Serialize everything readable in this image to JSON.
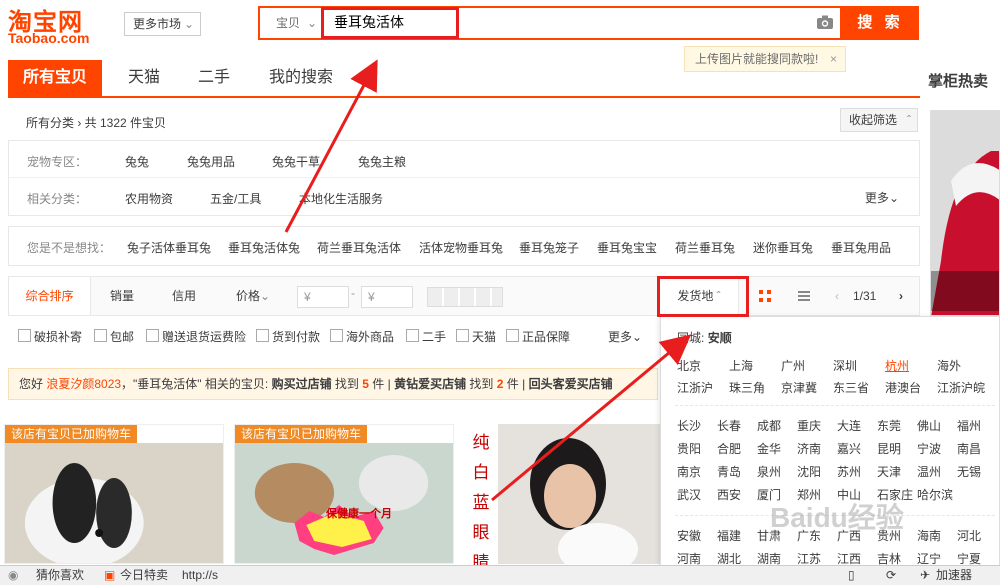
{
  "header": {
    "logo_cn": "淘宝网",
    "logo_en": "Taobao.com",
    "more_market": "更多市场",
    "search_type": "宝贝",
    "search_value": "垂耳兔活体",
    "search_button": "搜 索",
    "image_search_tip": "上传图片就能搜同款啦!",
    "tip_close": "×"
  },
  "tabs": [
    "所有宝贝",
    "天猫",
    "二手",
    "我的搜索"
  ],
  "side": {
    "title": "掌柜热卖"
  },
  "breadcrumb": "所有分类 › 共 1322 件宝贝",
  "fold_filter": "收起筛选",
  "categories": {
    "pet_label": "宠物专区：",
    "pet_items": [
      "兔兔",
      "兔兔用品",
      "兔兔干草",
      "兔兔主粮"
    ],
    "related_label": "相关分类：",
    "related_items": [
      "农用物资",
      "五金/工具",
      "本地化生活服务"
    ],
    "more": "更多"
  },
  "suggestions": {
    "label": "您是不是想找：",
    "items": [
      "兔子活体垂耳兔",
      "垂耳兔活体兔",
      "荷兰垂耳兔活体",
      "活体宠物垂耳兔",
      "垂耳兔笼子",
      "垂耳兔宝宝",
      "荷兰垂耳兔",
      "迷你垂耳兔",
      "垂耳兔用品"
    ]
  },
  "sort": {
    "items": [
      "综合排序",
      "销量",
      "信用",
      "价格"
    ],
    "price_from": "¥",
    "price_to": "¥",
    "ship_from": "发货地",
    "page": "1/31"
  },
  "filters": [
    "破损补寄",
    "包邮",
    "赠送退货运费险",
    "货到付款",
    "海外商品",
    "二手",
    "天猫",
    "正品保障"
  ],
  "filters_more": "更多",
  "notice": {
    "text1": "您好 ",
    "user": "浪夏汐颜8023",
    "text2": "，\"垂耳兔活体\" 相关的宝贝: ",
    "s1": "购买过店铺",
    "t1": " 找到 ",
    "n1": "5",
    "u1": " 件 ",
    "s2": "黄钻爱买店铺",
    "n2": "2",
    "s3": "回头客爱买店铺",
    "sep": " | "
  },
  "dropdown": {
    "same_city_label": "同城:",
    "same_city": "安顺",
    "row1": [
      "北京",
      "上海",
      "广州",
      "深圳",
      "杭州",
      "海外"
    ],
    "row2": [
      "江浙沪",
      "珠三角",
      "京津冀",
      "东三省",
      "港澳台",
      "江浙沪皖"
    ],
    "grid1": [
      [
        "长沙",
        "长春",
        "成都",
        "重庆",
        "大连",
        "东莞",
        "佛山",
        "福州"
      ],
      [
        "贵阳",
        "合肥",
        "金华",
        "济南",
        "嘉兴",
        "昆明",
        "宁波",
        "南昌"
      ],
      [
        "南京",
        "青岛",
        "泉州",
        "沈阳",
        "苏州",
        "天津",
        "温州",
        "无锡"
      ],
      [
        "武汉",
        "西安",
        "厦门",
        "郑州",
        "中山",
        "石家庄",
        "哈尔滨",
        ""
      ]
    ],
    "grid2": [
      [
        "安徽",
        "福建",
        "甘肃",
        "广东",
        "广西",
        "贵州",
        "海南",
        "河北"
      ],
      [
        "河南",
        "湖北",
        "湖南",
        "江苏",
        "江西",
        "吉林",
        "辽宁",
        "宁夏"
      ]
    ],
    "selected": "杭州"
  },
  "products": {
    "ribbon": "该店有宝贝已加购物车",
    "badge": "保健康一个月",
    "vertical_text": [
      "纯",
      "白",
      "蓝",
      "眼",
      "睛"
    ]
  },
  "statusbar": {
    "guess": "猜你喜欢",
    "today": "今日特卖",
    "url": "http://s",
    "accel": "加速器"
  },
  "watermark": "Baidu经验",
  "colors": {
    "accent": "#ff4400",
    "annotation": "#e81e1e",
    "ribbon": "#f08a24"
  }
}
